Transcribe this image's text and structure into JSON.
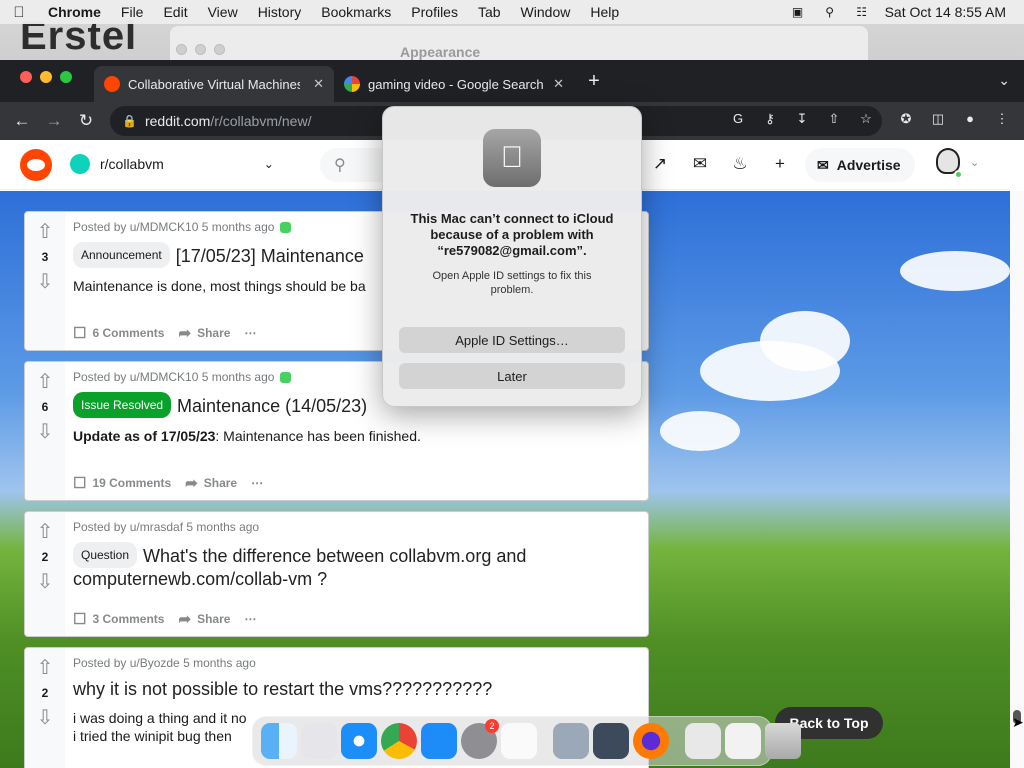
{
  "menubar": {
    "app_name": "Chrome",
    "items": [
      "File",
      "Edit",
      "View",
      "History",
      "Bookmarks",
      "Profiles",
      "Tab",
      "Window",
      "Help"
    ],
    "datetime": "Sat Oct 14  8:55 AM"
  },
  "background": {
    "window_title": "Appearance",
    "big_text": "Erstel"
  },
  "browser": {
    "tabs": [
      {
        "title": "Collaborative Virtual Machines",
        "active": true
      },
      {
        "title": "gaming video - Google Search",
        "active": false
      }
    ],
    "url_host": "reddit.com",
    "url_path": "/r/collabvm/new/"
  },
  "reddit": {
    "subreddit": "r/collabvm",
    "advertise_label": "Advertise",
    "back_to_top": "Back to Top",
    "posts": [
      {
        "score": "3",
        "meta": "Posted by u/MDMCK10 5 months ago",
        "flair": "Announcement",
        "title": "[17/05/23] Maintenance",
        "text": "Maintenance is done, most things should be ba",
        "comments": "6 Comments",
        "share": "Share"
      },
      {
        "score": "6",
        "meta": "Posted by u/MDMCK10 5 months ago",
        "flair": "Issue Resolved",
        "title": "Maintenance (14/05/23)",
        "text_bold": "Update as of 17/05/23",
        "text_rest": ": Maintenance has been finished.",
        "comments": "19 Comments",
        "share": "Share"
      },
      {
        "score": "2",
        "meta": "Posted by u/mrasdaf 5 months ago",
        "flair": "Question",
        "title": "What's the difference between collabvm.org and computernewb.com/collab-vm ?",
        "comments": "3 Comments",
        "share": "Share"
      },
      {
        "score": "2",
        "meta": "Posted by u/Byozde 5 months ago",
        "title": "why it is not possible to restart the vms???????????",
        "text": "i was doing a thing and it no",
        "text2": "i tried the winipit bug then"
      }
    ]
  },
  "dialog": {
    "title": "This Mac can’t connect to iCloud because of a problem with “re579082@gmail.com”.",
    "message": "Open Apple ID settings to fix this problem.",
    "primary_button": "Apple ID Settings…",
    "secondary_button": "Later"
  },
  "dock": {
    "badge_count": "2"
  },
  "colors": {
    "reddit_orange": "#ff4500",
    "issue_resolved_green": "#0aa12b"
  }
}
